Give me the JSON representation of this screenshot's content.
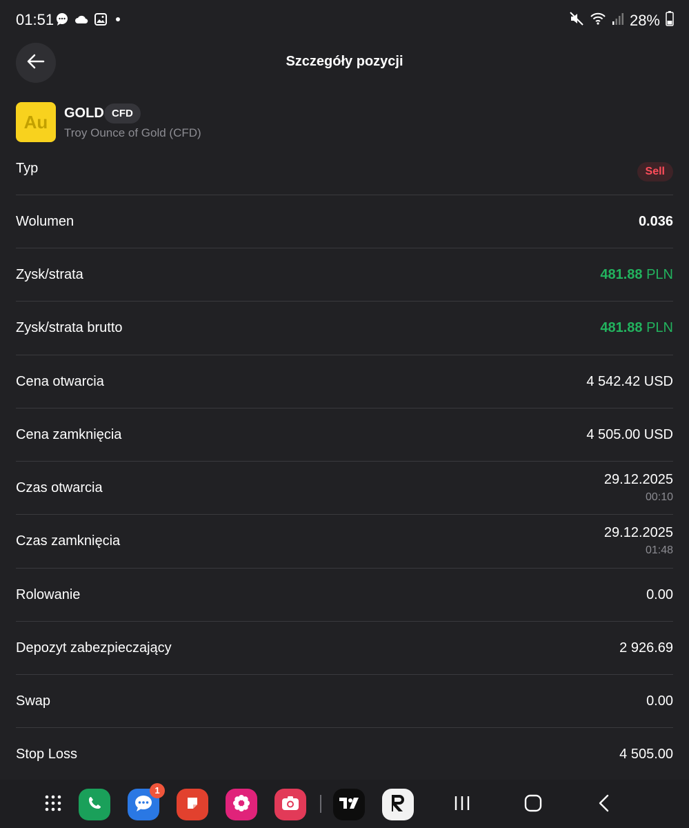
{
  "status_bar": {
    "time": "01:51",
    "battery_percent": "28%",
    "icons": [
      "message-icon",
      "cloud-icon",
      "gallery-icon",
      "dot-icon",
      "mute-icon",
      "wifi-icon",
      "signal-icon",
      "battery-icon"
    ]
  },
  "header": {
    "title": "Szczegóły pozycji"
  },
  "instrument": {
    "logo_text": "Au",
    "symbol": "GOLD",
    "badge": "CFD",
    "name": "Troy Ounce of Gold (CFD)"
  },
  "details": {
    "typ": {
      "label": "Typ",
      "value": "Sell"
    },
    "wolumen": {
      "label": "Wolumen",
      "value": "0.036"
    },
    "zysk": {
      "label": "Zysk/strata",
      "amount": "481.88",
      "currency": "PLN"
    },
    "zysk_brutto": {
      "label": "Zysk/strata brutto",
      "amount": "481.88",
      "currency": "PLN"
    },
    "cena_otwarcia": {
      "label": "Cena otwarcia",
      "value": "4 542.42 USD"
    },
    "cena_zamkniecia": {
      "label": "Cena zamknięcia",
      "value": "4 505.00 USD"
    },
    "czas_otwarcia": {
      "label": "Czas otwarcia",
      "date": "29.12.2025",
      "time": "00:10"
    },
    "czas_zamkniecia": {
      "label": "Czas zamknięcia",
      "date": "29.12.2025",
      "time": "01:48"
    },
    "rolowanie": {
      "label": "Rolowanie",
      "value": "0.00"
    },
    "depozyt": {
      "label": "Depozyt zabezpieczający",
      "value": "2 926.69"
    },
    "swap": {
      "label": "Swap",
      "value": "0.00"
    },
    "stop_loss": {
      "label": "Stop Loss",
      "value": "4 505.00"
    }
  },
  "dock": {
    "messages_badge": "1"
  },
  "colors": {
    "background": "#212124",
    "profit_green": "#22b35e",
    "sell_red": "#ff4d5a",
    "gold_yellow": "#f8d21e"
  }
}
